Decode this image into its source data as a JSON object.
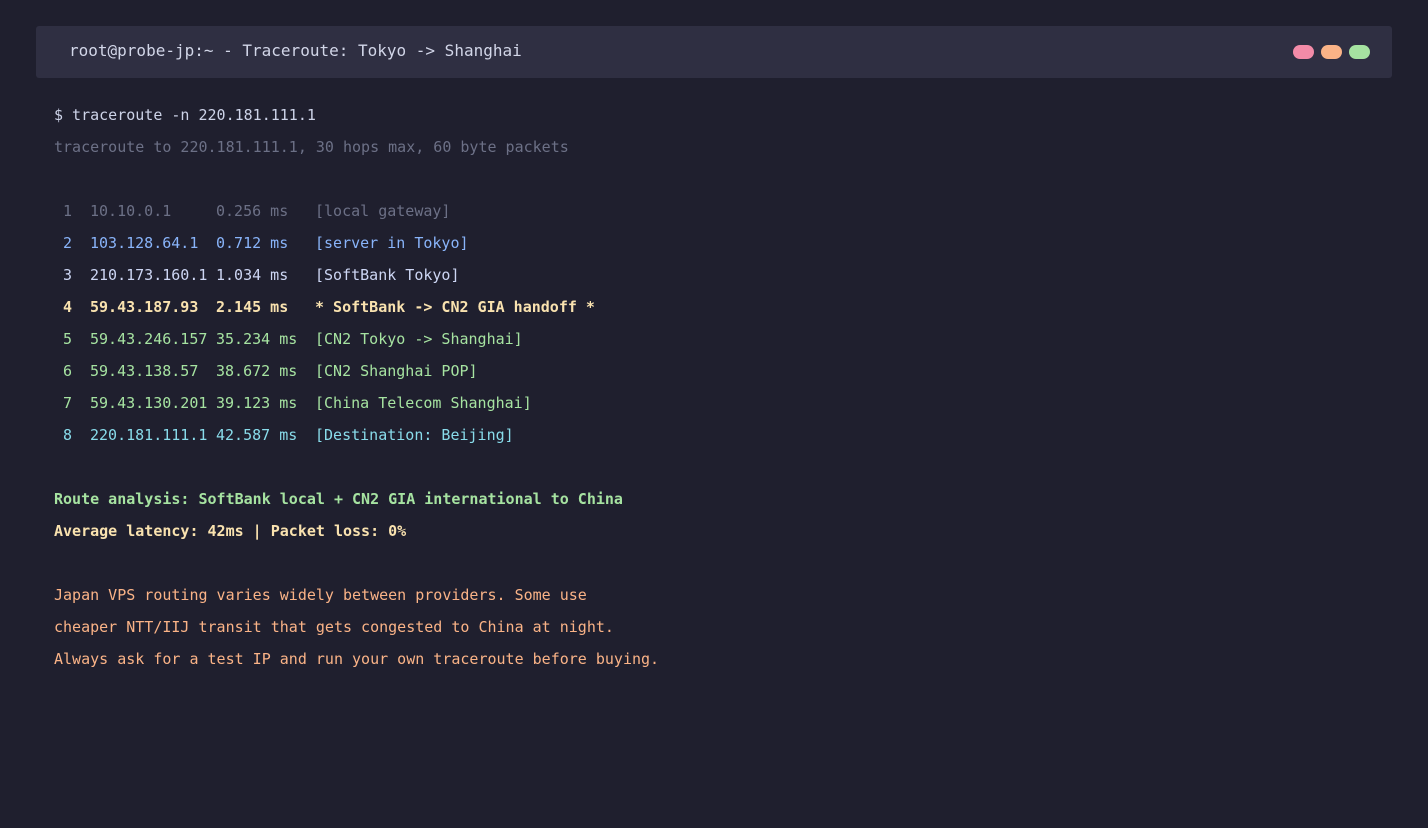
{
  "window": {
    "title": "root@probe-jp:~ - Traceroute: Tokyo -> Shanghai",
    "dots": [
      {
        "name": "close",
        "color": "#f38ba8"
      },
      {
        "name": "minimize",
        "color": "#fab387"
      },
      {
        "name": "maximize",
        "color": "#a6e3a1"
      }
    ]
  },
  "colors": {
    "background": "#1f1f2e",
    "muted": "#6c7086",
    "blue": "#89b4fa",
    "text": "#cdd6f4",
    "yellow": "#f9e2af",
    "green": "#a6e3a1",
    "cyan": "#89dceb",
    "peach": "#fab387"
  },
  "terminal": {
    "command": "$ traceroute -n 220.181.111.1",
    "header": "traceroute to 220.181.111.1, 30 hops max, 60 byte packets",
    "hops": [
      {
        "num": "1",
        "ip": "10.10.0.1",
        "ms": "0.256 ms",
        "note": "[local gateway]",
        "color": "#6c7086",
        "bold": false
      },
      {
        "num": "2",
        "ip": "103.128.64.1",
        "ms": "0.712 ms",
        "note": "[server in Tokyo]",
        "color": "#89b4fa",
        "bold": false
      },
      {
        "num": "3",
        "ip": "210.173.160.1",
        "ms": "1.034 ms",
        "note": "[SoftBank Tokyo]",
        "color": "#cdd6f4",
        "bold": false
      },
      {
        "num": "4",
        "ip": "59.43.187.93",
        "ms": "2.145 ms",
        "note": "* SoftBank -> CN2 GIA handoff *",
        "color": "#f9e2af",
        "bold": true
      },
      {
        "num": "5",
        "ip": "59.43.246.157",
        "ms": "35.234 ms",
        "note": "[CN2 Tokyo -> Shanghai]",
        "color": "#a6e3a1",
        "bold": false
      },
      {
        "num": "6",
        "ip": "59.43.138.57",
        "ms": "38.672 ms",
        "note": "[CN2 Shanghai POP]",
        "color": "#a6e3a1",
        "bold": false
      },
      {
        "num": "7",
        "ip": "59.43.130.201",
        "ms": "39.123 ms",
        "note": "[China Telecom Shanghai]",
        "color": "#a6e3a1",
        "bold": false
      },
      {
        "num": "8",
        "ip": "220.181.111.1",
        "ms": "42.587 ms",
        "note": "[Destination: Beijing]",
        "color": "#89dceb",
        "bold": false
      }
    ],
    "analysis": "Route analysis: SoftBank local + CN2 GIA international to China",
    "latency": "Average latency: 42ms | Packet loss: 0%",
    "notes": [
      "Japan VPS routing varies widely between providers. Some use",
      "cheaper NTT/IIJ transit that gets congested to China at night.",
      "Always ask for a test IP and run your own traceroute before buying."
    ]
  }
}
